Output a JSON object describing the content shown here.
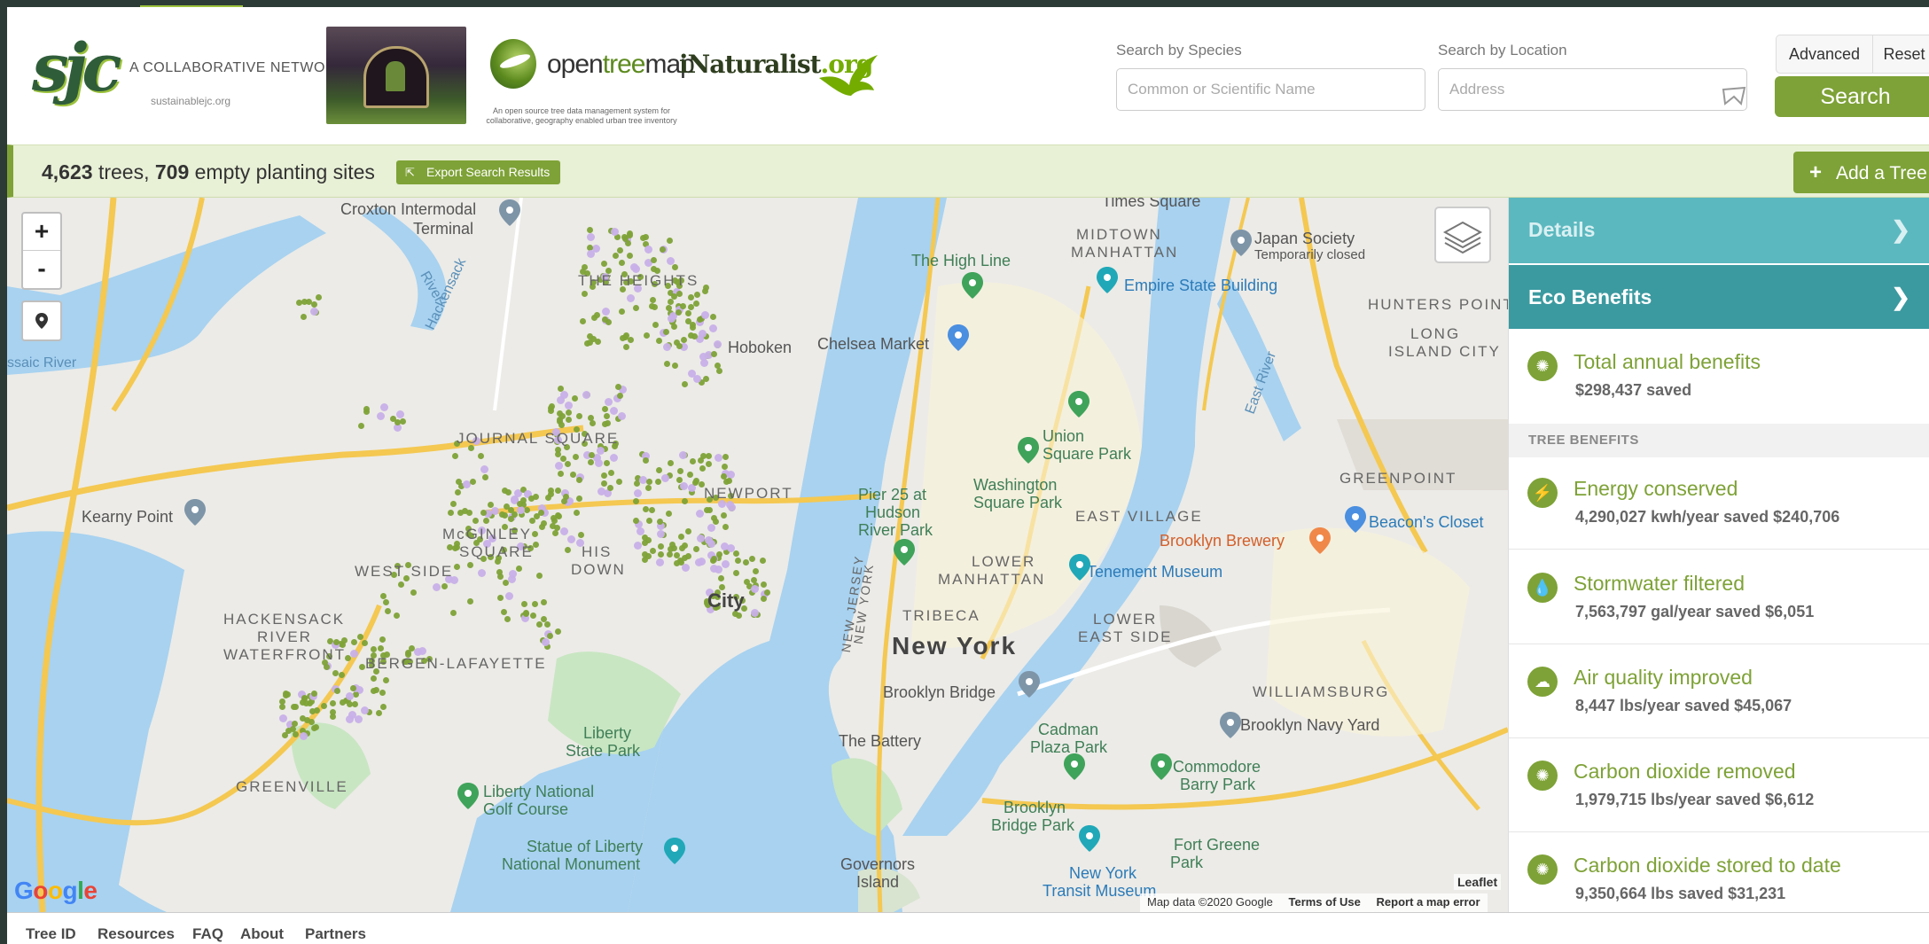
{
  "branding": {
    "sjc_mark": "sjc",
    "sjc_text": "A COLLABORATIVE NETWORK",
    "sjc_url": "sustainablejc.org",
    "otm_prefix": "open",
    "otm_highlight": "tree",
    "otm_suffix": "map",
    "otm_tagline": "An open source tree data management system for collaborative, geography enabled urban tree inventory",
    "inat_name": "iNaturalist",
    "inat_tld": ".org"
  },
  "search": {
    "species_label": "Search by Species",
    "species_placeholder": "Common or Scientific Name",
    "location_label": "Search by Location",
    "location_placeholder": "Address",
    "advanced_label": "Advanced",
    "reset_label": "Reset",
    "search_label": "Search"
  },
  "results": {
    "tree_count": "4,623",
    "trees_word": " trees, ",
    "site_count": "709",
    "sites_word": " empty planting sites",
    "export_label": "Export Search Results",
    "add_tree_label": "Add a Tree"
  },
  "map": {
    "zoom_in": "+",
    "zoom_out": "-",
    "labels": {
      "croxton": "Croxton Intermodal",
      "terminal": "Terminal",
      "the_heights": "THE HEIGHTS",
      "hoboken": "Hoboken",
      "chelsea_market": "Chelsea Market",
      "high_line": "The High Line",
      "midtown": "MIDTOWN",
      "manhattan": "MANHATTAN",
      "empire_state": "Empire State Building",
      "japan_society": "Japan Society",
      "temp_closed": "Temporarily closed",
      "hunters_point": "HUNTERS POINT",
      "long_island_city_1": "LONG",
      "long_island_city_2": "ISLAND CITY",
      "journal_square": "JOURNAL SQUARE",
      "union_square_1": "Union",
      "union_square_2": "Square Park",
      "greenpoint": "GREENPOINT",
      "kearny_point": "Kearny Point",
      "pier25_1": "Pier 25 at",
      "pier25_2": "Hudson",
      "pier25_3": "River Park",
      "washington_sq_1": "Washington",
      "washington_sq_2": "Square Park",
      "east_village": "EAST VILLAGE",
      "brooklyn_brewery": "Brooklyn Brewery",
      "beacons_closet": "Beacon's Closet",
      "newport": "NEWPORT",
      "mcginley_1": "McGINLEY",
      "mcginley_2": "SQUARE",
      "west_side": "WEST SIDE",
      "historic_downtown_1": "HIS",
      "historic_downtown_2": "DOWN",
      "jersey_city": "City",
      "lower_manhattan_1": "LOWER",
      "lower_manhattan_2": "MANHATTAN",
      "tenement": "Tenement Museum",
      "tribeca": "TRIBECA",
      "lower_east_side_1": "LOWER",
      "lower_east_side_2": "EAST SIDE",
      "new_york": "New York",
      "hackensack_1": "HACKENSACK",
      "hackensack_2": "RIVER",
      "hackensack_3": "WATERFRONT",
      "bergen": "BERGEN-LAFAYETTE",
      "williamsburg": "WILLIAMSBURG",
      "brooklyn_bridge": "Brooklyn Bridge",
      "liberty_sp_1": "Liberty",
      "liberty_sp_2": "State Park",
      "the_battery": "The Battery",
      "cadman_1": "Cadman",
      "cadman_2": "Plaza Park",
      "commodore_1": "Commodore",
      "commodore_2": "Barry Park",
      "navy_yard": "Brooklyn Navy Yard",
      "greenville": "GREENVILLE",
      "liberty_golf_1": "Liberty National",
      "liberty_golf_2": "Golf Course",
      "bb_park_1": "Brooklyn",
      "bb_park_2": "Bridge Park",
      "fort_greene_1": "Fort Greene",
      "fort_greene_2": "Park",
      "statue_1": "Statue of Liberty",
      "statue_2": "National Monument",
      "governors_1": "Governors",
      "governors_2": "Island",
      "transit_1": "New York",
      "transit_2": "Transit Museum",
      "new_jersey_1": "NEW JERSEY",
      "new_york_state_1": "NEW YORK",
      "hackensack_river": "Hackensack",
      "river": "River",
      "passaic_river": "ssaic River",
      "east_river": "East River",
      "times_square": "Times Square"
    },
    "attribution": {
      "map_data": "Map data ©2020 Google",
      "terms": "Terms of Use",
      "report": "Report a map error",
      "leaflet": "Leaflet"
    },
    "google_letters": [
      "G",
      "o",
      "o",
      "g",
      "l",
      "e"
    ]
  },
  "sidebar": {
    "details_label": "Details",
    "eco_label": "Eco Benefits",
    "total": {
      "title": "Total annual benefits",
      "value": "$298,437 saved",
      "icon": "sun-icon"
    },
    "section_label": "TREE BENEFITS",
    "benefits": [
      {
        "title": "Energy conserved",
        "value": "4,290,027 kwh/year saved $240,706",
        "icon": "lightning-icon",
        "glyph": "⚡"
      },
      {
        "title": "Stormwater filtered",
        "value": "7,563,797 gal/year saved $6,051",
        "icon": "droplet-icon",
        "glyph": "💧"
      },
      {
        "title": "Air quality improved",
        "value": "8,447 lbs/year saved $45,067",
        "icon": "cloud-icon",
        "glyph": "☁"
      },
      {
        "title": "Carbon dioxide removed",
        "value": "1,979,715 lbs/year saved $6,612",
        "icon": "sun-icon",
        "glyph": "✺"
      },
      {
        "title": "Carbon dioxide stored to date",
        "value": "9,350,664 lbs saved $31,231",
        "icon": "sun-icon",
        "glyph": "✺"
      }
    ]
  },
  "footer": {
    "links": [
      "Tree ID",
      "Resources",
      "FAQ",
      "About",
      "Partners"
    ]
  },
  "colors": {
    "brand_green": "#7ea237",
    "teal": "#3b9aa0",
    "teal_light": "#5bb8bf",
    "water": "#a8d2f0",
    "tree_dot": "#7ea237",
    "planting_site": "#c8b0e8"
  }
}
